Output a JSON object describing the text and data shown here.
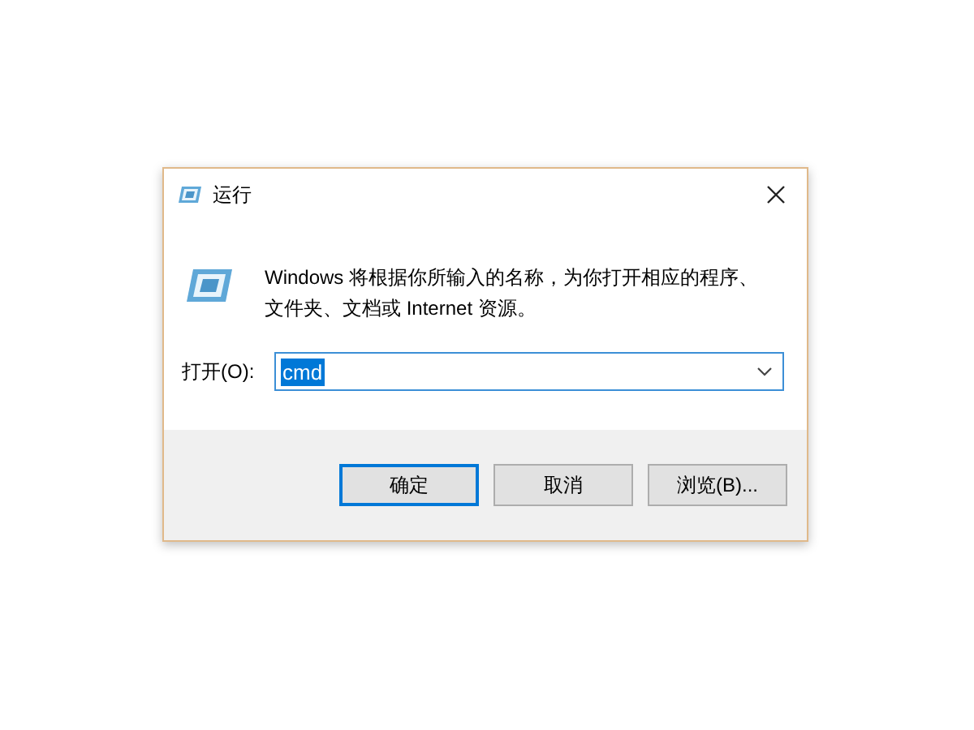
{
  "window": {
    "title": "运行"
  },
  "description": "Windows 将根据你所输入的名称，为你打开相应的程序、文件夹、文档或 Internet 资源。",
  "open_field": {
    "label": "打开(O):",
    "value": "cmd",
    "value_selected": true
  },
  "buttons": [
    {
      "label": "确定",
      "default": true
    },
    {
      "label": "取消",
      "default": false
    },
    {
      "label": "浏览(B)...",
      "default": false
    }
  ]
}
